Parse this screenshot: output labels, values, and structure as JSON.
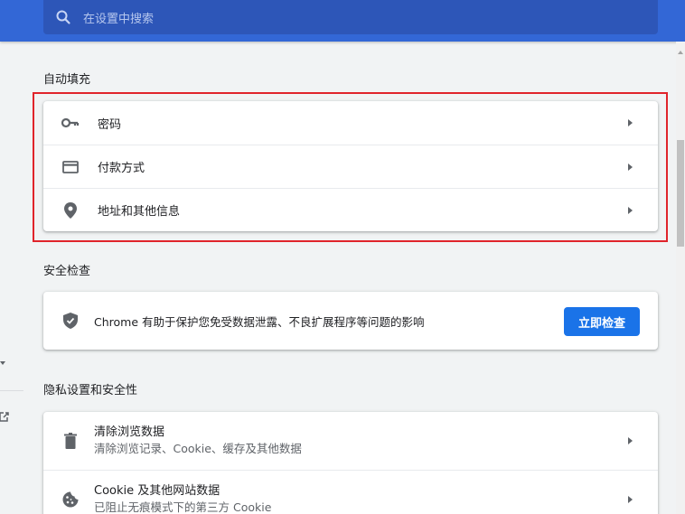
{
  "search": {
    "placeholder": "在设置中搜索"
  },
  "autofill": {
    "title": "自动填充",
    "items": [
      {
        "label": "密码",
        "icon": "key-icon"
      },
      {
        "label": "付款方式",
        "icon": "credit-card-icon"
      },
      {
        "label": "地址和其他信息",
        "icon": "location-pin-icon"
      }
    ]
  },
  "safety": {
    "title": "安全检查",
    "description": "Chrome 有助于保护您免受数据泄露、不良扩展程序等问题的影响",
    "button_label": "立即检查",
    "icon": "shield-check-icon"
  },
  "privacy": {
    "title": "隐私设置和安全性",
    "items": [
      {
        "primary": "清除浏览数据",
        "secondary": "清除浏览记录、Cookie、缓存及其他数据",
        "icon": "trash-icon"
      },
      {
        "primary": "Cookie 及其他网站数据",
        "secondary": "已阻止无痕模式下的第三方 Cookie",
        "icon": "cookie-icon"
      }
    ]
  },
  "colors": {
    "header": "#3367d6",
    "search_box": "#2d56b8",
    "accent_button": "#1a73e8",
    "highlight": "#e0242b",
    "background": "#f1f3f4"
  }
}
